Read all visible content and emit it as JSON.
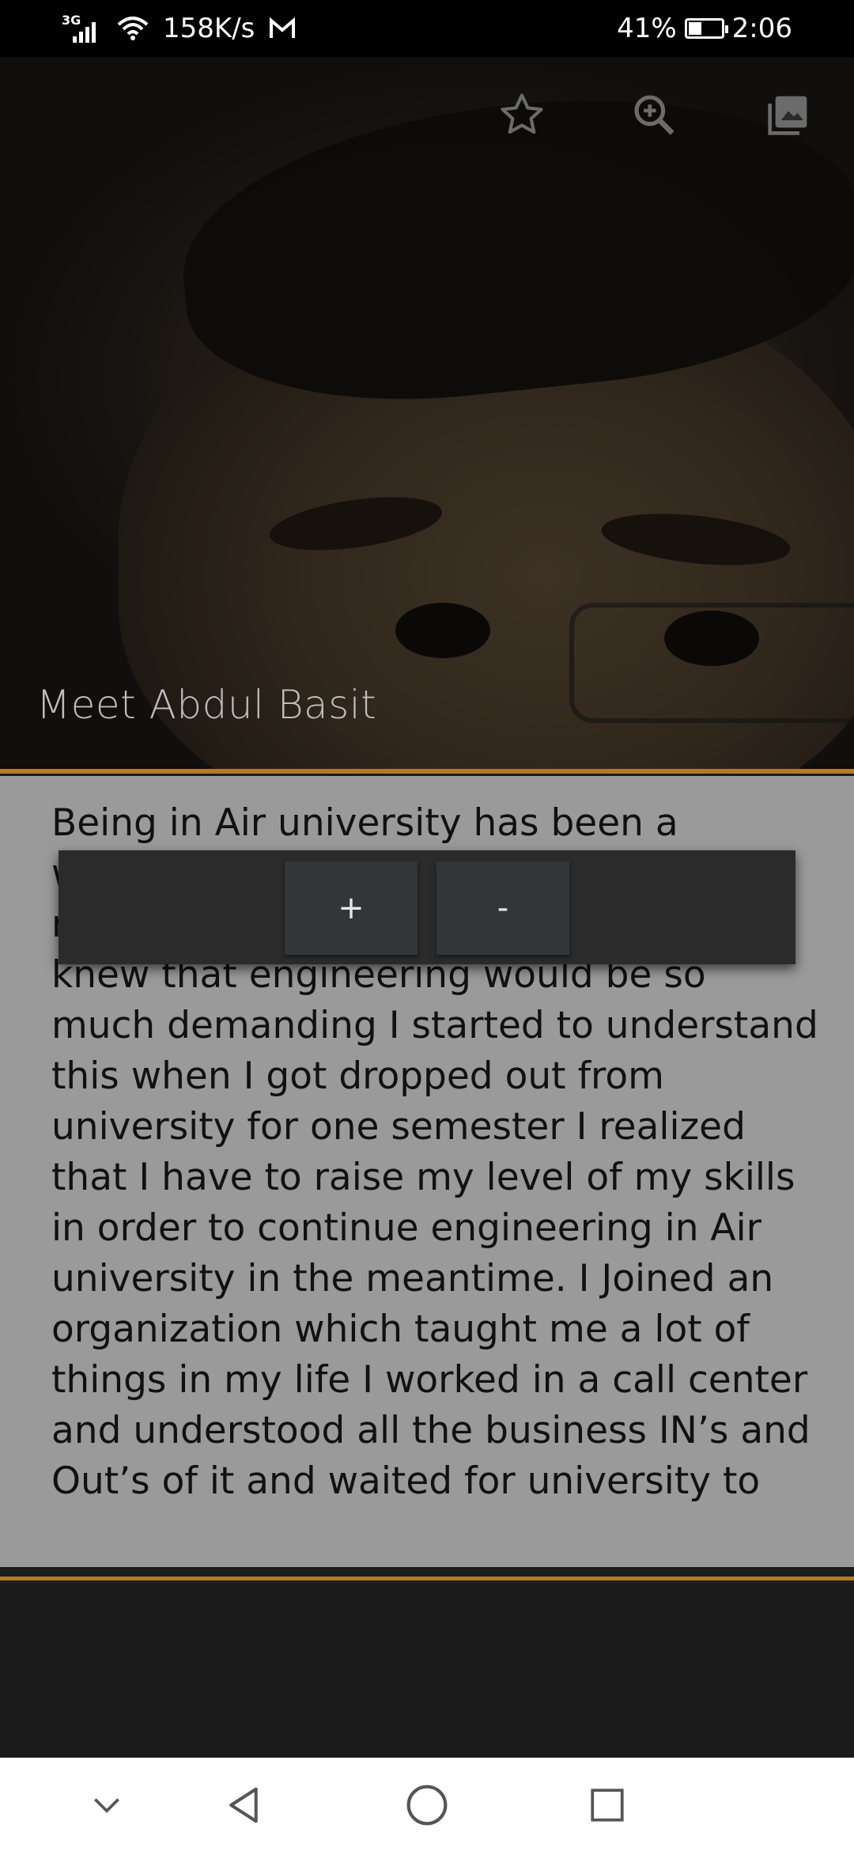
{
  "status_bar": {
    "network": "3G",
    "speed": "158K/s",
    "battery": "41%",
    "battery_level": 0.41,
    "time": "2:06"
  },
  "header": {
    "title": "Meet Abdul Basit",
    "icons": [
      "star-icon",
      "zoom-in-icon",
      "image-icon"
    ]
  },
  "content": {
    "body": "Being in Air university has been a wonderful journey. I was always good in maths and physics subjects but I didn’t knew that engineering would be so much demanding I started to understand this when I got dropped out from university for one semester I realized that I have to raise my level of my skills in order to continue engineering in Air university in the meantime. I Joined an organization which taught me a lot of things in my life I worked in a call center and understood all the business IN’s and Out’s of it and waited for university to"
  },
  "zoom_popup": {
    "plus_label": "+",
    "minus_label": "-"
  },
  "nav_bar": {
    "icons": [
      "chevron-down-icon",
      "back-icon",
      "home-icon",
      "recents-icon"
    ]
  },
  "colors": {
    "accent": "#b37a20",
    "content_bg": "#9a9a9a",
    "popup_bg": "#2b2b2b"
  }
}
